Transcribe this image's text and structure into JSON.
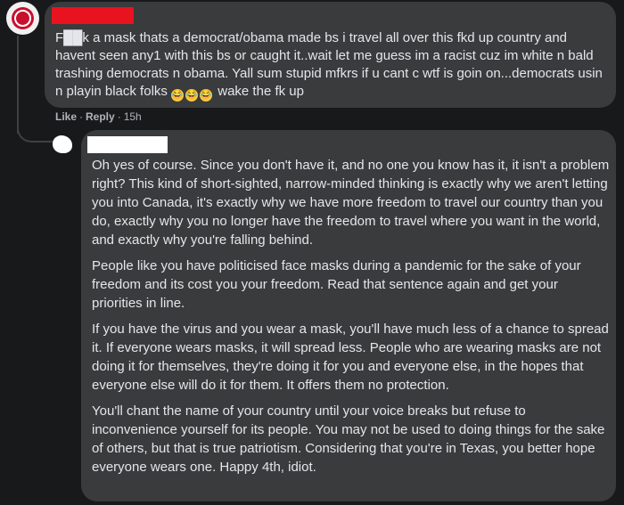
{
  "comment1": {
    "text": "F██k a mask thats a democrat/obama made bs i travel all over this fkd up country and havent seen any1 with this bs or caught it..wait let me guess im a racist cuz im white n bald trashing democrats n obama. Yall sum stupid mfkrs if u cant c wtf is goin on...democrats usin n playin black folks",
    "emojis": [
      "😂",
      "😂",
      "😂"
    ],
    "text_after_emojis": "wake the fk up",
    "actions": {
      "like": "Like",
      "reply": "Reply",
      "time": "15h"
    }
  },
  "comment2": {
    "paragraphs": [
      "Oh yes of course. Since you don't have it, and no one you know has it, it isn't a problem right? This kind of short-sighted, narrow-minded thinking is exactly why we aren't letting you into Canada, it's exactly why we have more freedom to travel our country than you do, exactly why you no longer have the freedom to travel where you want in the world, and exactly why you're falling behind.",
      "People like you have politicised face masks during a pandemic for the sake of your freedom and its cost you your freedom. Read that sentence again and get your priorities in line.",
      "If you have the virus and you wear a mask, you'll have much less of a chance to spread it. If everyone wears masks, it will spread less. People who are wearing masks are not doing it for themselves, they're doing it for you and everyone else, in the hopes that everyone else will do it for them. It offers them no protection.",
      "You'll chant the name of your country until your voice breaks but refuse to inconvenience yourself for its people. You may not be used to doing things for the sake of others, but that is true patriotism. Considering that you're in Texas, you better hope everyone wears one. Happy 4th, idiot."
    ]
  },
  "colors": {
    "background": "#18191a",
    "bubble": "#3a3b3c",
    "text": "#e4e6eb",
    "meta": "#b0b3b8",
    "redaction_red": "#e8131e",
    "redaction_white": "#ffffff"
  }
}
